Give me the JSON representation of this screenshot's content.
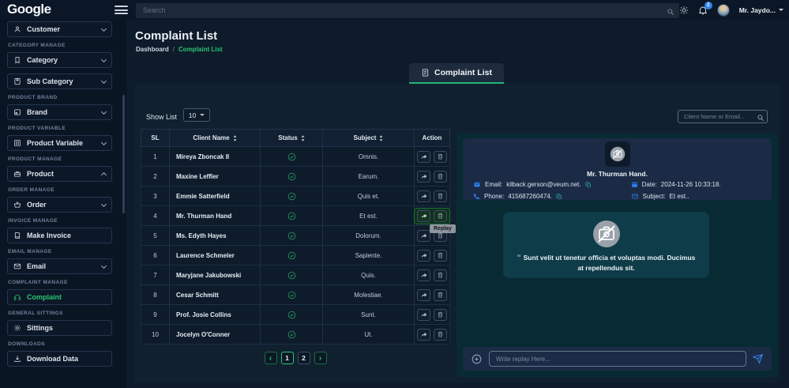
{
  "topbar": {
    "logo": "Google",
    "search_placeholder": "Search",
    "notification_count": "2",
    "user_name": "Mr. Jaydo..."
  },
  "sidebar": {
    "items": [
      {
        "section": "",
        "label": "Customer"
      },
      {
        "section": "CATEGORY MANAGE",
        "label": "Category"
      },
      {
        "section": "",
        "label": "Sub Category"
      },
      {
        "section": "PRODUCT BRAND",
        "label": "Brand"
      },
      {
        "section": "PRODUCT VARIABLE",
        "label": "Product Variable"
      },
      {
        "section": "PRODUCT MANAGE",
        "label": "Product"
      },
      {
        "section": "ORDER MANAGE",
        "label": "Order"
      },
      {
        "section": "INVOICE MANAGE",
        "label": "Make Invoice"
      },
      {
        "section": "EMAIL MANAGE",
        "label": "Email"
      },
      {
        "section": "COMPLAINT MANAGE",
        "label": "Complaint"
      },
      {
        "section": "GENERAL SITTINGS",
        "label": "Sittings"
      },
      {
        "section": "DOWNLOADS",
        "label": "Download Data"
      }
    ]
  },
  "header": {
    "title": "Complaint List",
    "breadcrumb_home": "Dashboard",
    "breadcrumb_sep": "/",
    "breadcrumb_current": "Complaint List"
  },
  "tab": {
    "label": "Complaint List"
  },
  "toolbar": {
    "show_label": "Show List",
    "page_size": "10",
    "search_placeholder": "Client Name or Email..."
  },
  "table": {
    "columns": [
      "SL",
      "Client Name",
      "Status",
      "Subject",
      "Action"
    ],
    "rows": [
      {
        "sl": "1",
        "name": "Mireya Zboncak II",
        "subject": "Omnis."
      },
      {
        "sl": "2",
        "name": "Maxine Leffler",
        "subject": "Earum."
      },
      {
        "sl": "3",
        "name": "Emmie Satterfield",
        "subject": "Quis et."
      },
      {
        "sl": "4",
        "name": "Mr. Thurman Hand",
        "subject": "Et est.",
        "selected": true
      },
      {
        "sl": "5",
        "name": "Ms. Edyth Hayes",
        "subject": "Dolorum."
      },
      {
        "sl": "6",
        "name": "Laurence Schmeler",
        "subject": "Sapiente."
      },
      {
        "sl": "7",
        "name": "Maryjane Jakubowski",
        "subject": "Quis."
      },
      {
        "sl": "8",
        "name": "Cesar Schmitt",
        "subject": "Molestiae."
      },
      {
        "sl": "9",
        "name": "Prof. Josie Collins",
        "subject": "Sunt."
      },
      {
        "sl": "10",
        "name": "Jocelyn O'Conner",
        "subject": "Ut."
      }
    ]
  },
  "tooltip": {
    "text": "Replay"
  },
  "pagination": {
    "prev": "‹",
    "page1": "1",
    "page2": "2",
    "next": "›",
    "active": "1"
  },
  "detail": {
    "name": "Mr. Thurman Hand.",
    "email_label": "Email:",
    "email": "kilback.gerson@veum.net.",
    "phone_label": "Phone:",
    "phone": "415687260474.",
    "date_label": "Date:",
    "date": "2024-11-26 10:33:18.",
    "subject_label": "Subject:",
    "subject": "Et est..",
    "quote_mark": "“",
    "message": "Sunt velit ut tenetur officia et voluptas modi. Ducimus at repellendus sit.",
    "reply_placeholder": "Write replay Here..."
  },
  "colors": {
    "accent_green": "#2bc572",
    "accent_blue": "#2f7df0",
    "badge_blue": "#2f86eb"
  }
}
